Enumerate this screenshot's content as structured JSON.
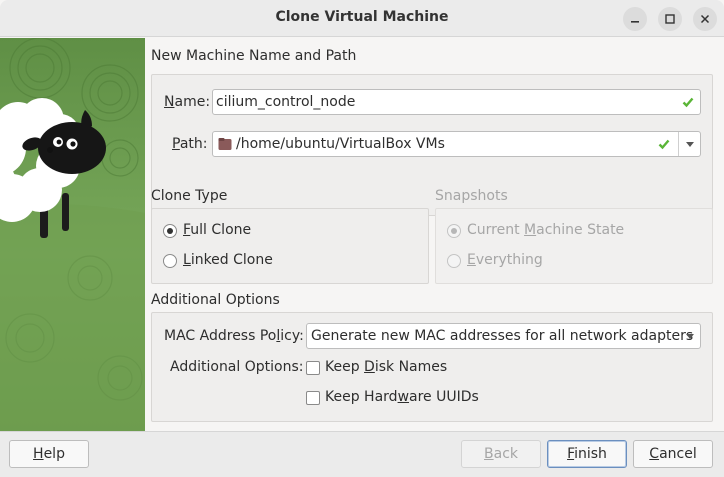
{
  "window": {
    "title": "Clone Virtual Machine"
  },
  "name_path": {
    "section_title": "New Machine Name and Path",
    "name_label_prefix": "N",
    "name_label_rest": "ame:",
    "name_value": "cilium_control_node",
    "path_label_prefix": "P",
    "path_label_rest": "ath:",
    "path_value": "/home/ubuntu/VirtualBox VMs"
  },
  "clone_type": {
    "section_title": "Clone Type",
    "full_clone_key": "F",
    "full_clone_rest": "ull Clone",
    "linked_clone_key": "L",
    "linked_clone_rest": "inked Clone",
    "selected": "Full Clone"
  },
  "snapshots": {
    "section_title": "Snapshots",
    "current_state_pre": "Current ",
    "current_state_key": "M",
    "current_state_post": "achine State",
    "everything_key": "E",
    "everything_rest": "verything",
    "selected": "Current Machine State"
  },
  "additional": {
    "section_title": "Additional Options",
    "mac_label_pre": "MAC Address Po",
    "mac_label_key": "l",
    "mac_label_post": "icy:",
    "mac_value": "Generate new MAC addresses for all network adapters",
    "options_label": "Additional Options:",
    "keep_disk_pre": "Keep ",
    "keep_disk_key": "D",
    "keep_disk_post": "isk Names",
    "keep_disk_checked": false,
    "keep_hw_pre": "Keep Hard",
    "keep_hw_key": "w",
    "keep_hw_post": "are UUIDs",
    "keep_hw_checked": false
  },
  "buttons": {
    "help_key": "H",
    "help_rest": "elp",
    "back_key": "B",
    "back_rest": "ack",
    "finish_key": "F",
    "finish_rest": "inish",
    "cancel_key": "C",
    "cancel_rest": "ancel"
  },
  "colors": {
    "panel_green": "#6a9a4c",
    "check_green": "#5ab537",
    "default_button_border": "#6b8fbf"
  },
  "icons": [
    "minimize-icon",
    "maximize-icon",
    "close-icon",
    "valid-check-icon",
    "folder-icon",
    "dropdown-arrow-icon",
    "sheep-illustration"
  ]
}
